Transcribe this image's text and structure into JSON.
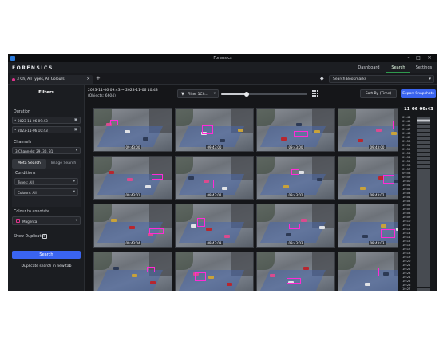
{
  "window": {
    "title": "Forensics"
  },
  "header": {
    "brand": "FORENSICS",
    "nav": [
      {
        "label": "Dashboard"
      },
      {
        "label": "Search"
      },
      {
        "label": "Settings"
      }
    ]
  },
  "tabs": {
    "active_tab": "3 Ch, All Types, All Colours",
    "close_glyph": "×",
    "add_glyph": "+",
    "bookmarks_label": "Search Bookmarks"
  },
  "filters": {
    "heading": "Filters",
    "duration_label": "Duration",
    "start": "2023-11-06 09:43",
    "end": "2023-11-06 10:43",
    "channels_label": "Channels",
    "channels_value": "3 Channels: 29, 30, 31",
    "tabs": [
      {
        "label": "Meta Search"
      },
      {
        "label": "Image Search"
      }
    ],
    "conditions_label": "Conditions",
    "types_value": "Types: All",
    "colours_value": "Colours: All",
    "colour_to_annotate_label": "Colour to annotate",
    "colour_value": "Magenta",
    "show_duplicates_label": "Show Duplicates",
    "search_button": "Search",
    "duplicate_link": "Duplicate search in new tab",
    "accent_color": "#3a64f0",
    "annotate_color": "#e0338c"
  },
  "results": {
    "range": "2023-11-06 09:43 ~ 2023-11-06 10:43",
    "objects": "(Objects: 6604)",
    "filter_button": "Filter 1Ch...",
    "zoom_slider_level": 0.3,
    "sort_button": "Sort By (Time)",
    "export_button": "Export Snapshots",
    "thumbnails": [
      {
        "time": "09:43:00"
      },
      {
        "time": "09:43:00"
      },
      {
        "time": "09:43:00"
      },
      {
        "time": "09:43:00"
      },
      {
        "time": "09:43:01"
      },
      {
        "time": "09:43:02"
      },
      {
        "time": "09:43:02"
      },
      {
        "time": "09:43:02"
      },
      {
        "time": "09:43:04"
      },
      {
        "time": "09:43:03"
      },
      {
        "time": "09:43:03"
      },
      {
        "time": "09:43:03"
      },
      {
        "time": ""
      },
      {
        "time": ""
      },
      {
        "time": ""
      },
      {
        "time": ""
      }
    ]
  },
  "timeline": {
    "current": "11-06 09:43",
    "ticks": [
      "09:44",
      "09:45",
      "09:46",
      "09:47",
      "09:48",
      "09:49",
      "09:50",
      "09:51",
      "09:52",
      "09:53",
      "09:54",
      "09:55",
      "09:56",
      "09:57",
      "09:58",
      "09:59",
      "10:00",
      "10:01",
      "10:02",
      "10:03",
      "10:04",
      "10:05",
      "10:06",
      "10:07",
      "10:08",
      "10:09",
      "10:10",
      "10:11",
      "10:12",
      "10:13",
      "10:14",
      "10:15",
      "10:16",
      "10:17",
      "10:18",
      "10:19",
      "10:20",
      "10:21",
      "10:22",
      "10:23",
      "10:24",
      "10:25",
      "10:26",
      "10:27"
    ]
  }
}
